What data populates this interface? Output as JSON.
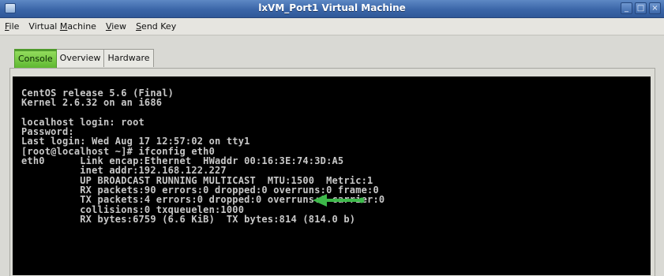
{
  "window": {
    "title": "lxVM_Port1 Virtual Machine",
    "buttons": [
      "_",
      "□",
      "×"
    ]
  },
  "menu": [
    {
      "accel": "F",
      "rest": "ile"
    },
    {
      "pre": "Virtual ",
      "accel": "M",
      "rest": "achine"
    },
    {
      "accel": "V",
      "rest": "iew"
    },
    {
      "accel": "S",
      "rest": "end Key"
    }
  ],
  "tabs": [
    "Console",
    "Overview",
    "Hardware"
  ],
  "active_tab": "Console",
  "console": {
    "lines": [
      "CentOS release 5.6 (Final)",
      "Kernel 2.6.32 on an i686",
      "",
      "localhost login: root",
      "Password:",
      "Last login: Wed Aug 17 12:57:02 on tty1",
      "[root@localhost ~]# ifconfig eth0",
      "eth0      Link encap:Ethernet  HWaddr 00:16:3E:74:3D:A5",
      "          inet addr:192.168.122.227",
      "          UP BROADCAST RUNNING MULTICAST  MTU:1500  Metric:1",
      "          RX packets:90 errors:0 dropped:0 overruns:0 frame:0",
      "          TX packets:4 errors:0 dropped:0 overruns:0 carrier:0",
      "          collisions:0 txqueuelen:1000",
      "          RX bytes:6759 (6.6 KiB)  TX bytes:814 (814.0 b)"
    ],
    "highlight_arrow_color": "#3db84a"
  }
}
